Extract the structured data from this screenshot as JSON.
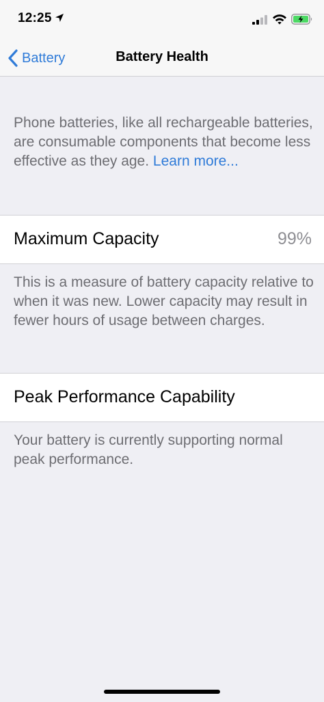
{
  "status_bar": {
    "time": "12:25",
    "icons": [
      "location-arrow-icon",
      "cellular-signal-icon",
      "wifi-icon",
      "battery-charging-icon"
    ],
    "battery_color": "#4cd964"
  },
  "nav": {
    "back_label": "Battery",
    "title": "Battery Health"
  },
  "intro": {
    "text": "Phone batteries, like all rechargeable batteries, are consumable components that become less effective as they age.",
    "link": "Learn more..."
  },
  "max_capacity": {
    "label": "Maximum Capacity",
    "value": "99%",
    "footer": "This is a measure of battery capacity relative to when it was new. Lower capacity may result in fewer hours of usage between charges."
  },
  "peak_performance": {
    "label": "Peak Performance Capability",
    "footer": "Your battery is currently supporting normal peak performance."
  },
  "colors": {
    "accent": "#2f7bd8",
    "background": "#efeff4",
    "secondary_text": "#6d6d72",
    "value_text": "#8e8e93"
  }
}
